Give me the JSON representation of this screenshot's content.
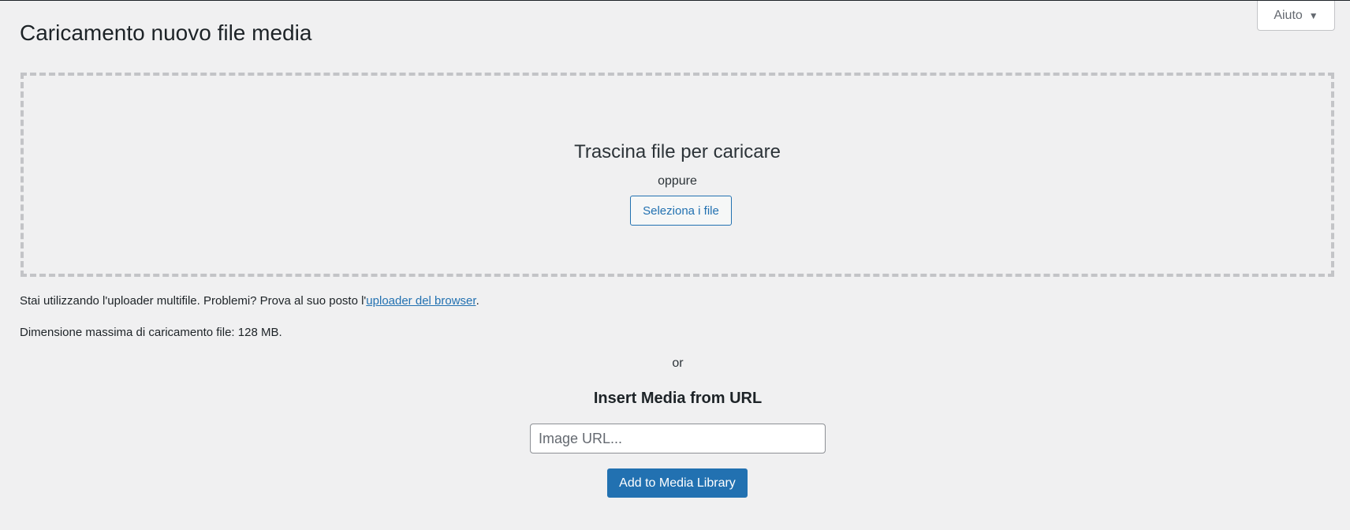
{
  "help": {
    "label": "Aiuto",
    "arrow": "▼"
  },
  "page_title": "Caricamento nuovo file media",
  "dropzone": {
    "title": "Trascina file per caricare",
    "or": "oppure",
    "select_button": "Seleziona i file"
  },
  "uploader_info": {
    "text": "Stai utilizzando l'uploader multifile. Problemi? Prova al suo posto l'",
    "link": "uploader del browser",
    "suffix": "."
  },
  "max_size": "Dimensione massima di caricamento file: 128 MB.",
  "url_section": {
    "or": "or",
    "heading": "Insert Media from URL",
    "placeholder": "Image URL...",
    "button": "Add to Media Library"
  },
  "colors": {
    "background": "#f0f0f1",
    "accent": "#2271b1",
    "dashed_border": "#c3c4c7"
  }
}
